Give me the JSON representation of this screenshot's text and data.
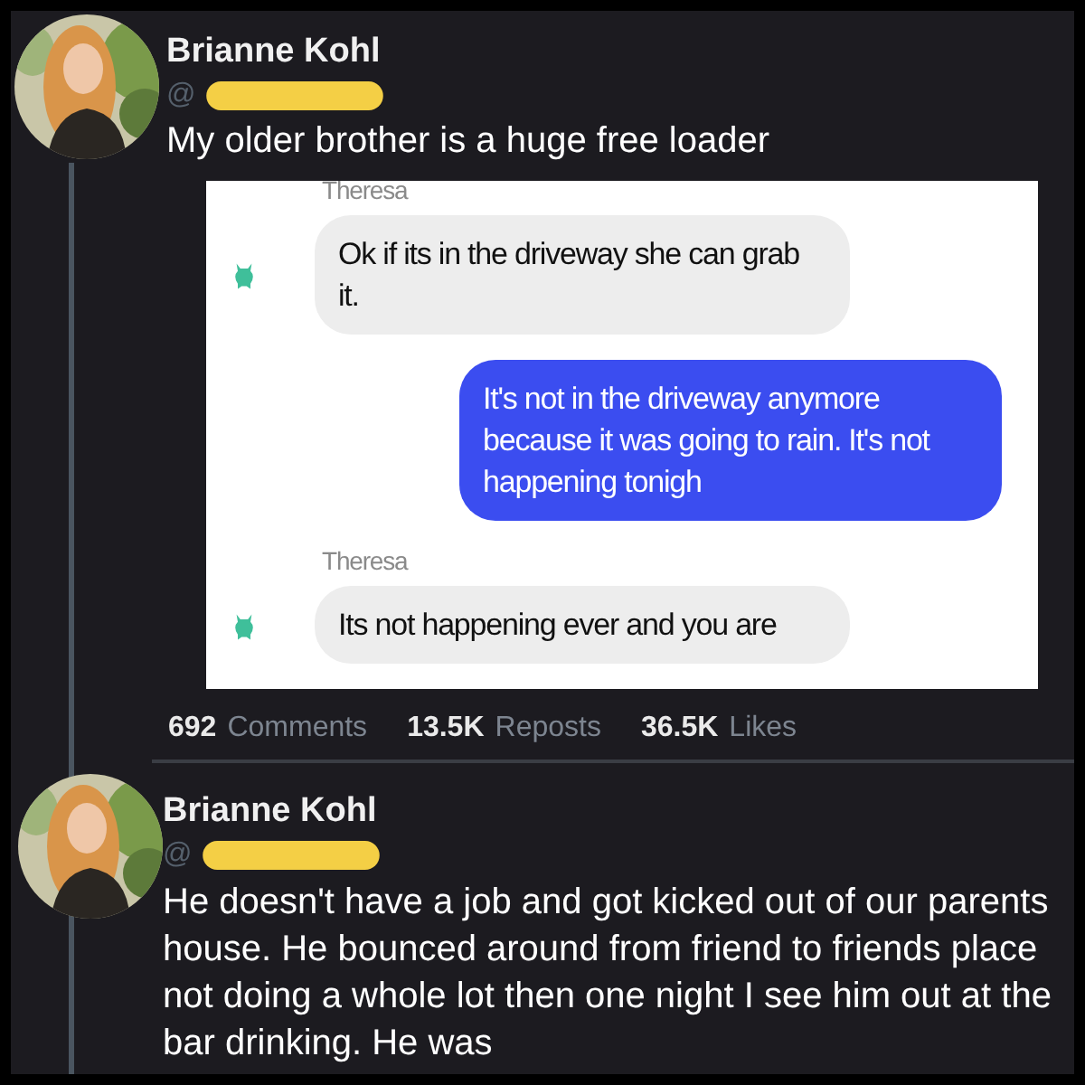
{
  "posts": [
    {
      "author": "Brianne Kohl",
      "handle": "@",
      "text": "My older brother is a huge free loader",
      "chat": [
        {
          "kind": "sender",
          "label": "Theresa"
        },
        {
          "kind": "incoming",
          "text": "Ok if its in the driveway she can grab it."
        },
        {
          "kind": "outgoing",
          "text": "It's not in the driveway anymore because it was going to rain. It's not happening tonigh"
        },
        {
          "kind": "sender",
          "label": "Theresa"
        },
        {
          "kind": "incoming",
          "text": "Its not happening ever and you are"
        }
      ],
      "stats": [
        {
          "count": "692",
          "label": "Comments"
        },
        {
          "count": "13.5K",
          "label": "Reposts"
        },
        {
          "count": "36.5K",
          "label": "Likes"
        }
      ]
    },
    {
      "author": "Brianne Kohl",
      "handle": "@",
      "text": " He doesn't have a job and got kicked out of our parents house. He bounced around from friend to friends place not doing a whole lot then one night I see him out at the bar drinking. He was"
    }
  ]
}
